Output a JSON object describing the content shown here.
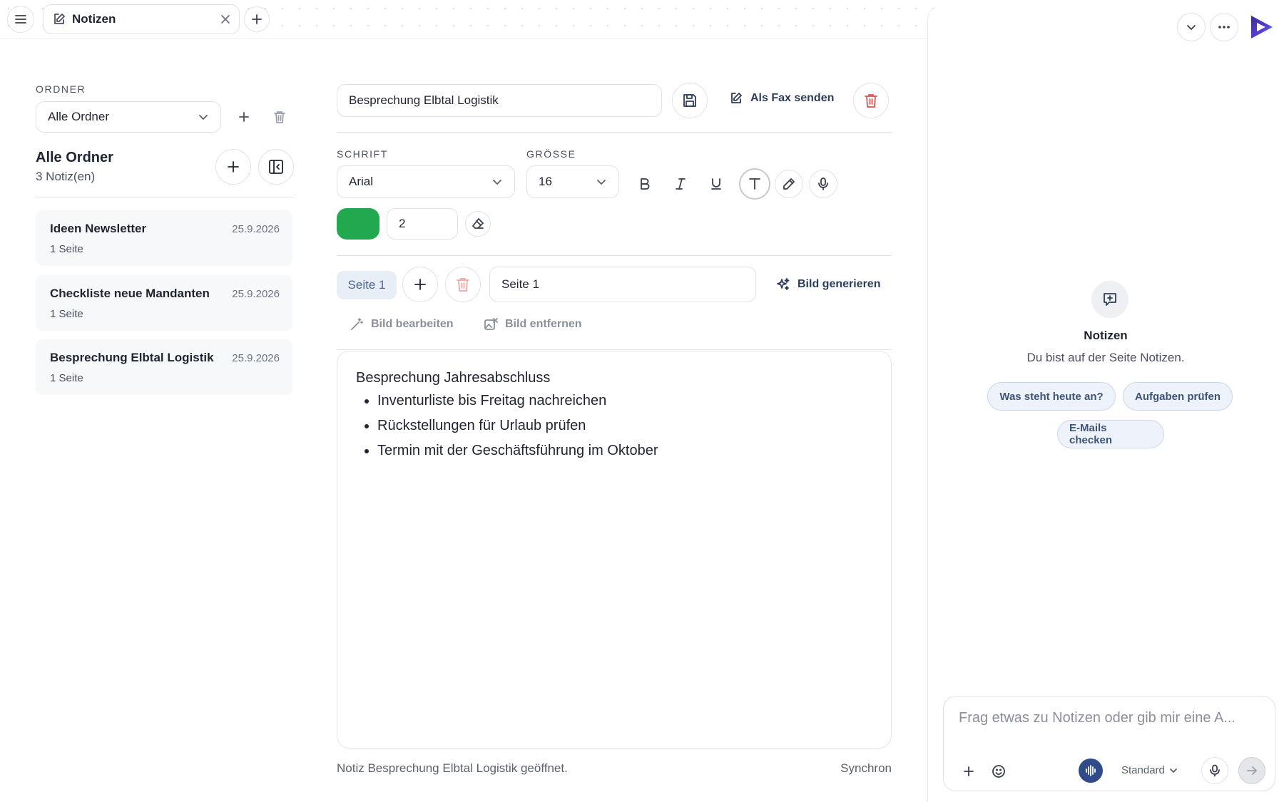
{
  "tabbar": {
    "tab_label": "Notizen"
  },
  "folders": {
    "section_label": "ORDNER",
    "selected_folder": "Alle Ordner",
    "list_title": "Alle Ordner",
    "list_count": "3 Notiz(en)"
  },
  "notes": [
    {
      "title": "Ideen Newsletter",
      "date": "25.9.2026",
      "pages": "1 Seite"
    },
    {
      "title": "Checkliste neue Mandanten",
      "date": "25.9.2026",
      "pages": "1 Seite"
    },
    {
      "title": "Besprechung Elbtal Logistik",
      "date": "25.9.2026",
      "pages": "1 Seite"
    }
  ],
  "editor": {
    "title_value": "Besprechung Elbtal Logistik",
    "fax_label": "Als Fax senden",
    "font_label": "SCHRIFT",
    "font_value": "Arial",
    "size_label": "GRÖSSE",
    "size_value": "16",
    "pen_color": "#22a94f",
    "pen_width": "2",
    "page_pill": "Seite 1",
    "page_name_value": "Seite 1",
    "generate_image": "Bild generieren",
    "edit_image": "Bild bearbeiten",
    "remove_image": "Bild entfernen",
    "content_heading": "Besprechung Jahresabschluss",
    "content_items": [
      "Inventurliste bis Freitag nachreichen",
      "Rückstellungen für Urlaub prüfen",
      "Termin mit der Geschäftsführung im Oktober"
    ],
    "status_message": "Notiz Besprechung Elbtal Logistik geöffnet.",
    "sync_status": "Synchron"
  },
  "assistant": {
    "context_title": "Notizen",
    "context_subtitle": "Du bist auf der Seite Notizen.",
    "suggestions": [
      "Was steht heute an?",
      "Aufgaben prüfen",
      "E-Mails checken"
    ],
    "input_placeholder": "Frag etwas zu Notizen oder gib mir eine A...",
    "mode_label": "Standard"
  },
  "colors": {
    "accent": "#2c3e5c",
    "delete": "#d9534f",
    "voice": "#2f4b8a"
  }
}
